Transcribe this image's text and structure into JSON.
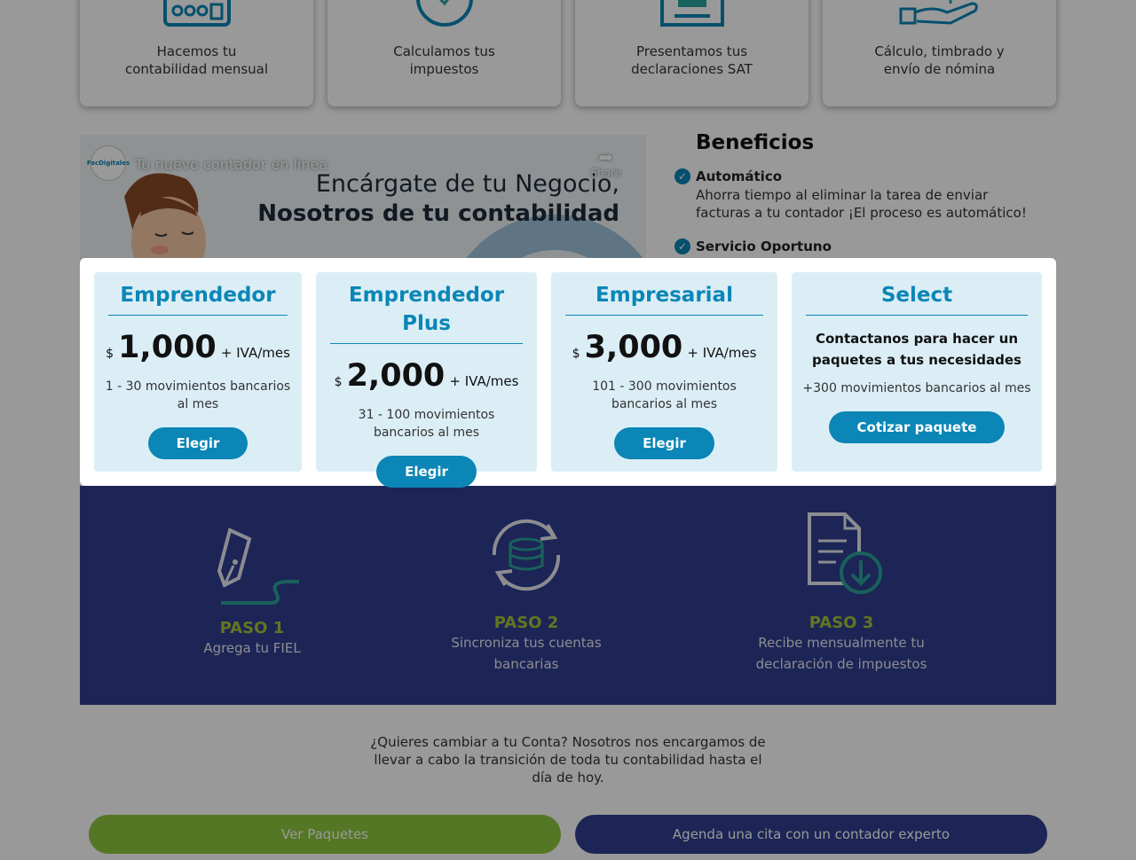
{
  "services": [
    {
      "label": "Hacemos tu\ncontabilidad mensual",
      "icon": "calculator-icon"
    },
    {
      "label": "Calculamos tus\nimpuestos",
      "icon": "percent-circle-icon"
    },
    {
      "label": "Presentamos tus\ndeclaraciones SAT",
      "icon": "upload-tray-icon"
    },
    {
      "label": "Cálculo, timbrado y\nenvío de nómina",
      "icon": "hand-money-icon"
    }
  ],
  "video": {
    "title": "Tu nuevo contador en línea",
    "share": "Share",
    "logo": "FacDigitales",
    "line1": "Encárgate de tu Negocio,",
    "line2": "Nosotros de tu contabilidad"
  },
  "benefits": {
    "title": "Beneficios",
    "items": [
      {
        "title": "Automático",
        "text": "Ahorra tiempo al eliminar la tarea de enviar facturas a tu contador ¡El proceso es automático!"
      },
      {
        "title": "Servicio Oportuno",
        "text": ""
      }
    ]
  },
  "plans": [
    {
      "name": "Emprendedor",
      "currency": "$",
      "amount": "1,000",
      "suffix": "+ IVA/mes",
      "desc": "1 - 30 movimientos bancarios al mes",
      "button": "Elegir"
    },
    {
      "name": "Emprendedor Plus",
      "currency": "$",
      "amount": "2,000",
      "suffix": "+ IVA/mes",
      "desc": "31 - 100 movimientos bancarios al mes",
      "button": "Elegir"
    },
    {
      "name": "Empresarial",
      "currency": "$",
      "amount": "3,000",
      "suffix": "+ IVA/mes",
      "desc": "101 - 300 movimientos bancarios al mes",
      "button": "Elegir"
    }
  ],
  "select_plan": {
    "name": "Select",
    "contact": "Contactanos para hacer un paquetes a tus necesidades",
    "desc": "+300 movimientos bancarios al mes",
    "button": "Cotizar paquete"
  },
  "steps": [
    {
      "title": "PASO 1",
      "text": "Agrega tu FIEL",
      "icon": "pen-signature-icon"
    },
    {
      "title": "PASO 2",
      "text": "Sincroniza tus cuentas bancarias",
      "icon": "database-sync-icon"
    },
    {
      "title": "PASO 3",
      "text": "Recibe mensualmente tu declaración de impuestos",
      "icon": "document-download-icon"
    }
  ],
  "transition_text": "¿Quieres cambiar a tu Conta? Nosotros nos encargamos de llevar a cabo la transición de toda tu contabilidad hasta el día de hoy.",
  "cta": {
    "packages": "Ver Paquetes",
    "appointment": "Agenda una cita con un contador experto"
  },
  "colors": {
    "accent": "#0b86b6",
    "steps_bg": "#2f3f8f",
    "step_title": "#a7c43a",
    "green_button": "#8cc63f",
    "blue_button": "#2f3f8f",
    "plan_bg": "#dbeef6"
  }
}
